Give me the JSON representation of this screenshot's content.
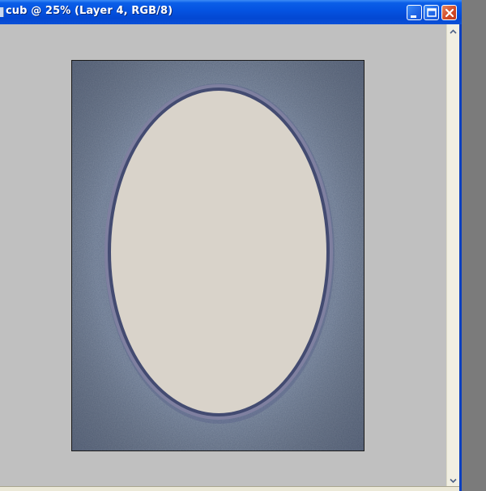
{
  "window": {
    "title": "cub @ 25% (Layer 4, RGB/8)"
  },
  "colors": {
    "titlebar": "#0452e0",
    "workspace": "#c0c0c0",
    "canvas_fill": "#65738b",
    "frame_outer": "#7e7f9e",
    "frame_inner": "#404a6e",
    "oval_fill": "#d9d3ca",
    "close_button": "#d24b28"
  },
  "icons": {
    "minimize": "minimize-icon",
    "maximize": "maximize-icon",
    "close": "close-icon",
    "scroll_up": "scroll-up-arrow-icon",
    "scroll_down": "scroll-down-arrow-icon"
  }
}
